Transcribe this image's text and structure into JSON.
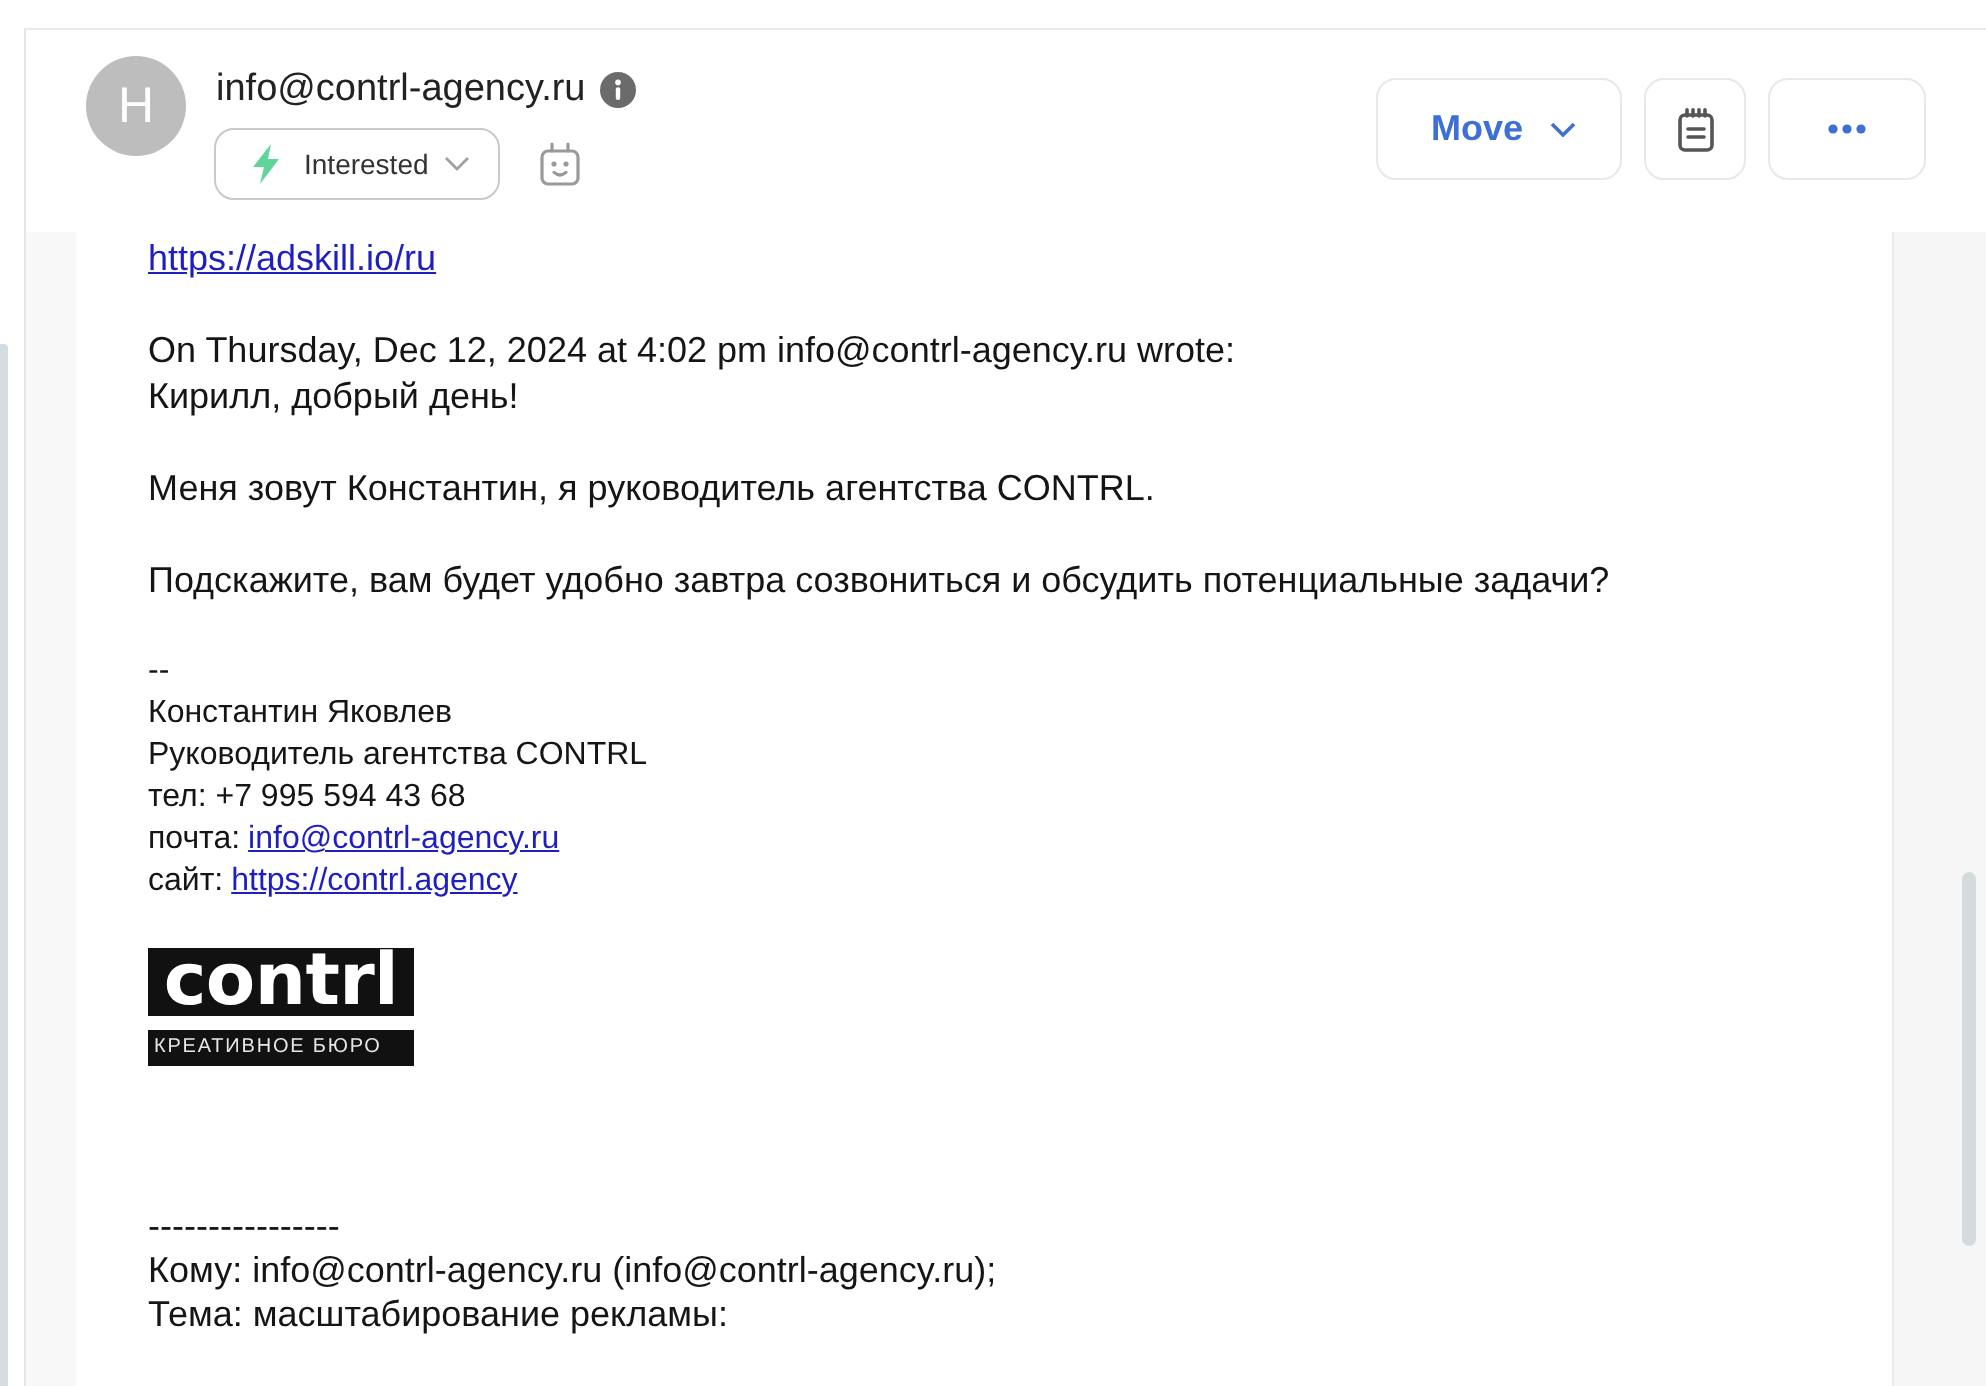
{
  "header": {
    "avatar": {
      "letter": "H"
    },
    "sender": "info@contrl-agency.ru",
    "status_label": {
      "text": "Interested"
    },
    "actions": [
      {
        "kind": "move",
        "label": "Move"
      },
      {
        "kind": "notes"
      },
      {
        "kind": "more"
      }
    ]
  },
  "message": {
    "blocks": [
      {
        "kind": "link",
        "text": "https://adskill.io/ru"
      },
      {
        "kind": "paragraph",
        "lines": [
          "On Thursday, Dec 12, 2024 at 4:02 pm info@contrl-agency.ru wrote:",
          "Кирилл, добрый день!"
        ]
      },
      {
        "kind": "paragraph",
        "lines": [
          "Меня зовут Константин, я руководитель агентства CONTRL."
        ]
      },
      {
        "kind": "paragraph",
        "lines": [
          "Подскажите, вам будет удобно завтра созвониться и обсудить потенциальные задачи?"
        ]
      },
      {
        "kind": "signature",
        "separator": "--",
        "lines": [
          {
            "text": "Константин Яковлев"
          },
          {
            "text": "Руководитель агентства CONTRL"
          },
          {
            "text": "тел: +7 995 594 43 68"
          },
          {
            "text": "почта:",
            "link": "info@contrl-agency.ru"
          },
          {
            "text": "сайт:",
            "link": "https://contrl.agency"
          }
        ]
      },
      {
        "kind": "logo",
        "wordmark": "contrl",
        "tagline": "КРЕАТИВНОЕ БЮРО"
      },
      {
        "kind": "forwarded",
        "separator": "----------------",
        "lines": [
          "Кому: info@contrl-agency.ru (info@contrl-agency.ru);",
          "Тема: масштабирование рекламы:"
        ]
      }
    ]
  }
}
